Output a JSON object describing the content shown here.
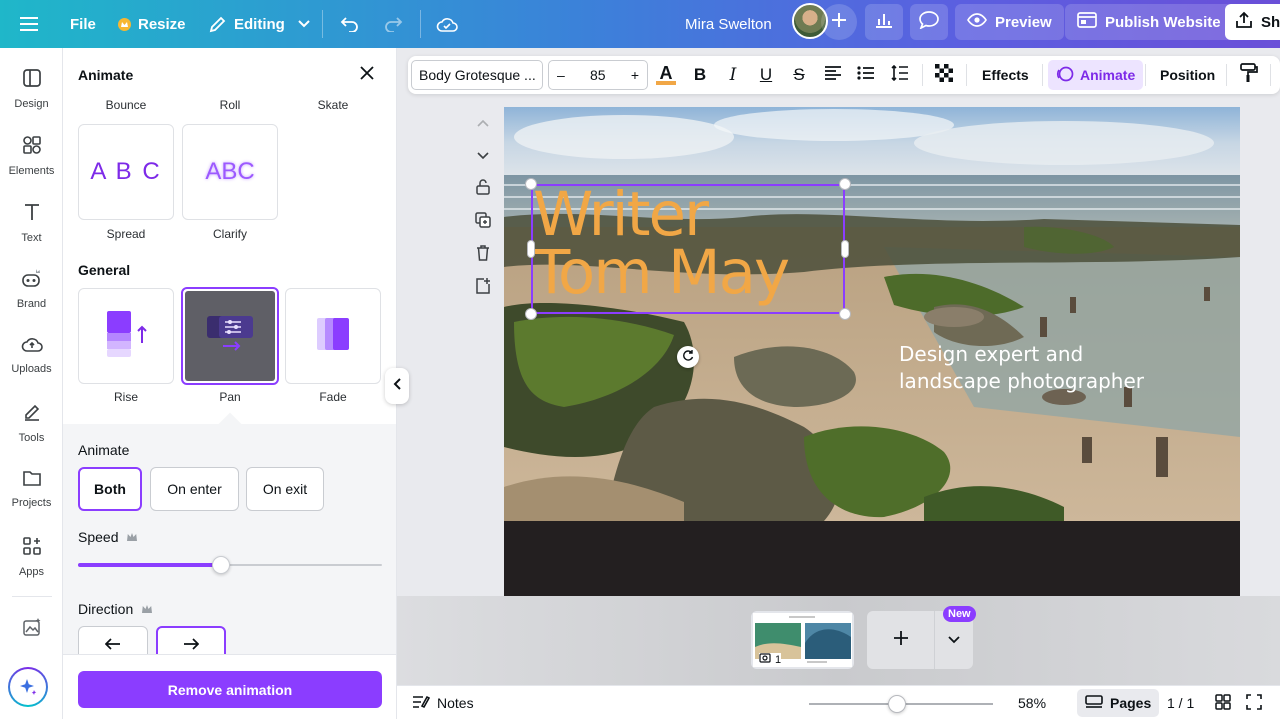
{
  "topbar": {
    "file": "File",
    "resize": "Resize",
    "editing": "Editing",
    "user_name": "Mira Swelton",
    "preview": "Preview",
    "publish": "Publish Website",
    "share": "Share"
  },
  "rail": {
    "items": [
      "Design",
      "Elements",
      "Text",
      "Brand",
      "Uploads",
      "Tools",
      "Projects",
      "Apps"
    ]
  },
  "panel": {
    "title": "Animate",
    "top_labels": [
      "Bounce",
      "Roll",
      "Skate"
    ],
    "row2": [
      {
        "label": "Spread",
        "preview": "A B C"
      },
      {
        "label": "Clarify",
        "preview": "ABC"
      }
    ],
    "general_heading": "General",
    "general": [
      "Rise",
      "Pan",
      "Fade"
    ],
    "animate_heading": "Animate",
    "animate_options": [
      "Both",
      "On enter",
      "On exit"
    ],
    "speed_label": "Speed",
    "speed_level": 0.47,
    "direction_label": "Direction",
    "remove_button": "Remove animation"
  },
  "toolbar": {
    "font": "Body Grotesque ...",
    "font_size": "85",
    "effects": "Effects",
    "animate": "Animate",
    "position": "Position"
  },
  "canvas": {
    "title_line1": "Writer",
    "title_line2": "Tom May",
    "subtitle_line1": "Design expert and",
    "subtitle_line2": "landscape photographer"
  },
  "pages": {
    "thumb_number": "1",
    "new_badge": "New"
  },
  "footer": {
    "notes": "Notes",
    "zoom": "58%",
    "pages": "Pages",
    "page_count": "1 / 1"
  },
  "colors": {
    "accent": "#8b3dff",
    "title_text": "#f1a746"
  }
}
